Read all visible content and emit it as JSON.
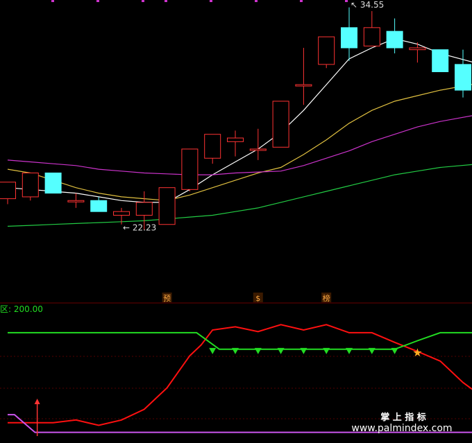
{
  "chart_data": [
    {
      "type": "candlestick",
      "panel": "price",
      "xlim": [
        0,
        21
      ],
      "ylim": [
        20.5,
        35.5
      ],
      "candles": [
        {
          "x": 0,
          "open": 25.0,
          "close": 25.9,
          "high": 25.9,
          "low": 24.7
        },
        {
          "x": 1,
          "open": 25.1,
          "close": 26.4,
          "high": 26.4,
          "low": 24.9
        },
        {
          "x": 2,
          "open": 26.4,
          "close": 25.3,
          "high": 26.4,
          "low": 25.3
        },
        {
          "x": 3,
          "open": 24.9,
          "close": 24.9,
          "high": 25.3,
          "low": 24.5
        },
        {
          "x": 4,
          "open": 24.9,
          "close": 24.3,
          "high": 25.1,
          "low": 24.3
        },
        {
          "x": 5,
          "open": 24.1,
          "close": 24.3,
          "high": 24.5,
          "low": 23.6
        },
        {
          "x": 6,
          "open": 24.1,
          "close": 24.8,
          "high": 25.4,
          "low": 23.3
        },
        {
          "x": 7,
          "open": 23.6,
          "close": 25.6,
          "high": 25.6,
          "low": 23.6
        },
        {
          "x": 8,
          "open": 25.5,
          "close": 27.7,
          "high": 27.7,
          "low": 25.4
        },
        {
          "x": 9,
          "open": 27.2,
          "close": 28.5,
          "high": 28.5,
          "low": 26.9
        },
        {
          "x": 10,
          "open": 28.1,
          "close": 28.3,
          "high": 28.7,
          "low": 27.3
        },
        {
          "x": 11,
          "open": 27.7,
          "close": 27.7,
          "high": 28.8,
          "low": 27.1
        },
        {
          "x": 12,
          "open": 27.8,
          "close": 30.3,
          "high": 30.3,
          "low": 27.8
        },
        {
          "x": 13,
          "open": 31.2,
          "close": 31.2,
          "high": 33.2,
          "low": 30.1
        },
        {
          "x": 14,
          "open": 32.3,
          "close": 33.8,
          "high": 33.8,
          "low": 32.1
        },
        {
          "x": 15,
          "open": 34.3,
          "close": 33.2,
          "high": 35.4,
          "low": 32.5
        },
        {
          "x": 16,
          "open": 33.3,
          "close": 34.3,
          "high": 35.2,
          "low": 33.3
        },
        {
          "x": 17,
          "open": 34.1,
          "close": 33.2,
          "high": 34.8,
          "low": 32.9
        },
        {
          "x": 18,
          "open": 33.1,
          "close": 33.2,
          "high": 33.5,
          "low": 32.4
        },
        {
          "x": 19,
          "open": 33.1,
          "close": 31.9,
          "high": 33.1,
          "low": 31.9
        },
        {
          "x": 20,
          "open": 32.3,
          "close": 30.9,
          "high": 33.1,
          "low": 30.5
        }
      ],
      "series": [
        {
          "color": "#ffffff",
          "x": [
            0,
            1,
            2,
            3,
            4,
            5,
            6,
            7,
            8,
            9,
            10,
            11,
            12,
            13,
            14,
            15,
            16,
            17,
            18,
            19,
            20.8
          ],
          "values": [
            25.6,
            25.5,
            25.4,
            25.3,
            25.1,
            24.9,
            24.8,
            24.8,
            25.5,
            26.3,
            27.0,
            27.7,
            28.6,
            29.8,
            31.2,
            32.6,
            33.2,
            33.7,
            33.4,
            32.9,
            32.3
          ]
        },
        {
          "color": "#e0c040",
          "x": [
            0,
            1,
            2,
            3,
            4,
            5,
            6,
            7,
            8,
            9,
            10,
            11,
            12,
            13,
            14,
            15,
            16,
            17,
            18,
            19,
            20.8
          ],
          "values": [
            26.6,
            26.4,
            26.0,
            25.6,
            25.3,
            25.1,
            25.0,
            24.9,
            25.2,
            25.6,
            26.0,
            26.4,
            26.7,
            27.4,
            28.2,
            29.1,
            29.8,
            30.3,
            30.6,
            30.9,
            31.3
          ]
        },
        {
          "color": "#cc33cc",
          "x": [
            0,
            1,
            2,
            3,
            4,
            5,
            6,
            7,
            8,
            9,
            10,
            11,
            12,
            13,
            14,
            15,
            16,
            17,
            18,
            19,
            20.8
          ],
          "values": [
            27.1,
            27.0,
            26.9,
            26.8,
            26.6,
            26.5,
            26.4,
            26.35,
            26.3,
            26.3,
            26.4,
            26.45,
            26.5,
            26.8,
            27.2,
            27.6,
            28.1,
            28.5,
            28.9,
            29.2,
            29.6
          ]
        },
        {
          "color": "#22cc44",
          "x": [
            0,
            1,
            2,
            3,
            4,
            5,
            6,
            7,
            8,
            9,
            10,
            11,
            12,
            13,
            14,
            15,
            16,
            17,
            18,
            19,
            20.8
          ],
          "values": [
            23.5,
            23.55,
            23.6,
            23.65,
            23.7,
            23.75,
            23.8,
            23.9,
            24.0,
            24.1,
            24.3,
            24.5,
            24.8,
            25.1,
            25.4,
            25.7,
            26.0,
            26.3,
            26.5,
            26.7,
            26.9
          ]
        }
      ],
      "annotations": [
        {
          "text": "34.55",
          "x": 15,
          "y": 35.4,
          "arrow": "↖"
        },
        {
          "text": "22.23",
          "x": 5,
          "y": 23.6,
          "arrow": "←"
        }
      ],
      "markers": [
        {
          "text": "预",
          "x": 7
        },
        {
          "text": "$",
          "x": 11
        },
        {
          "text": "榜",
          "x": 14
        }
      ]
    },
    {
      "type": "line",
      "panel": "indicator",
      "title": "区: 200.00",
      "xlim": [
        0,
        21
      ],
      "ylim": [
        -20,
        200
      ],
      "series": [
        {
          "color": "#ff1010",
          "x": [
            0,
            1,
            2,
            3,
            4,
            5,
            6,
            7,
            8,
            8.5,
            9,
            10,
            11,
            12,
            13,
            14,
            15,
            16,
            17,
            18,
            19,
            20,
            20.8
          ],
          "values": [
            5,
            5,
            5,
            10,
            0,
            10,
            30,
            70,
            130,
            150,
            178,
            184,
            175,
            188,
            178,
            188,
            173,
            173,
            155,
            138,
            120,
            80,
            55
          ]
        },
        {
          "color": "#22dd22",
          "x": [
            0,
            8.3,
            9.3,
            10,
            11,
            12,
            13,
            14,
            15,
            16,
            17,
            18,
            19,
            20,
            20.8
          ],
          "values": [
            173,
            173,
            142,
            142,
            142,
            142,
            142,
            142,
            142,
            142,
            142,
            158,
            173,
            173,
            173
          ]
        },
        {
          "color": "#cc55ee",
          "x": [
            0,
            0.3,
            1.2,
            1.3,
            20.8
          ],
          "values": [
            20,
            20,
            -13,
            -13,
            -13
          ]
        }
      ],
      "arrow_markers": [
        9,
        10,
        11,
        12,
        13,
        14,
        15,
        16,
        17
      ],
      "star_marker": {
        "x": 18,
        "y": 135
      },
      "up_arrow_marker": {
        "x": 1.3
      }
    }
  ],
  "watermark": {
    "line1": "掌 上 指 标",
    "line2": "www.palmindex.com"
  }
}
